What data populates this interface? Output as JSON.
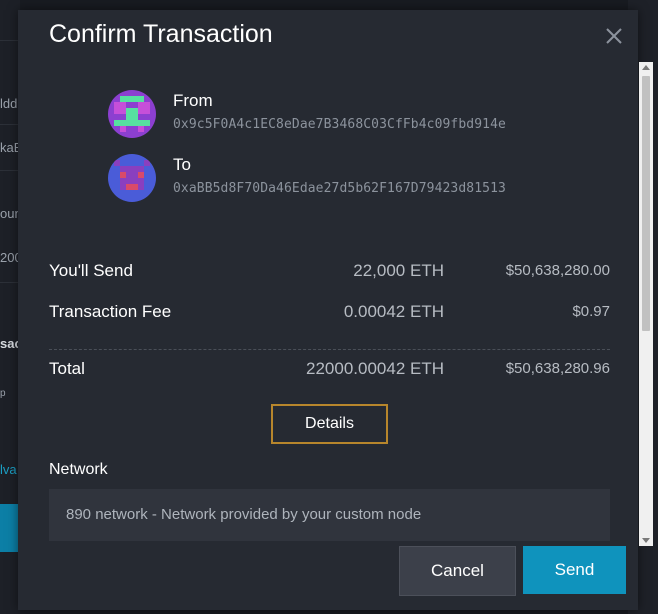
{
  "modal": {
    "title": "Confirm Transaction",
    "close_icon": "close-icon"
  },
  "from": {
    "label": "From",
    "address": "0x9c5F0A4c1EC8eDae7B3468C03CfFb4c09fbd914e",
    "avatar_colors": [
      "#8c3fd0",
      "#57e0a0",
      "#c64fd9"
    ]
  },
  "to": {
    "label": "To",
    "address": "0xaBB5d8F70Da46Edae27d5b62F167D79423d81513",
    "avatar_colors": [
      "#4a5cd8",
      "#8a3fbf",
      "#d94a6a"
    ]
  },
  "summary": {
    "send": {
      "label": "You'll Send",
      "eth": "22,000 ETH",
      "usd": "$50,638,280.00"
    },
    "fee": {
      "label": "Transaction Fee",
      "eth": "0.00042 ETH",
      "usd": "$0.97"
    },
    "total": {
      "label": "Total",
      "eth": "22000.00042 ETH",
      "usd": "$50,638,280.96"
    }
  },
  "details_label": "Details",
  "network": {
    "label": "Network",
    "value": "890 network - Network provided by your custom node"
  },
  "actions": {
    "cancel_label": "Cancel",
    "send_label": "Send"
  },
  "background": {
    "fragments": [
      "ldd",
      "kaB",
      "oun",
      "200",
      "sac",
      "p",
      "lva"
    ]
  },
  "colors": {
    "modal_bg": "#262a32",
    "accent_button": "#0f93bd",
    "details_border": "#b7862c"
  }
}
